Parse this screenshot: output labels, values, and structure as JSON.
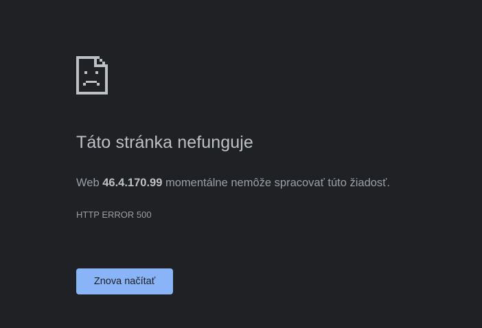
{
  "error": {
    "icon": "sad-document-icon",
    "title": "Táto stránka nefunguje",
    "message_prefix": "Web ",
    "host": "46.4.170.99",
    "message_suffix": " momentálne nemôže spracovať túto žiadosť.",
    "code": "HTTP ERROR 500"
  },
  "actions": {
    "reload_label": "Znova načítať"
  },
  "colors": {
    "background": "#202124",
    "title": "#bdc1c6",
    "text": "#9aa0a6",
    "button": "#8ab4f8"
  }
}
